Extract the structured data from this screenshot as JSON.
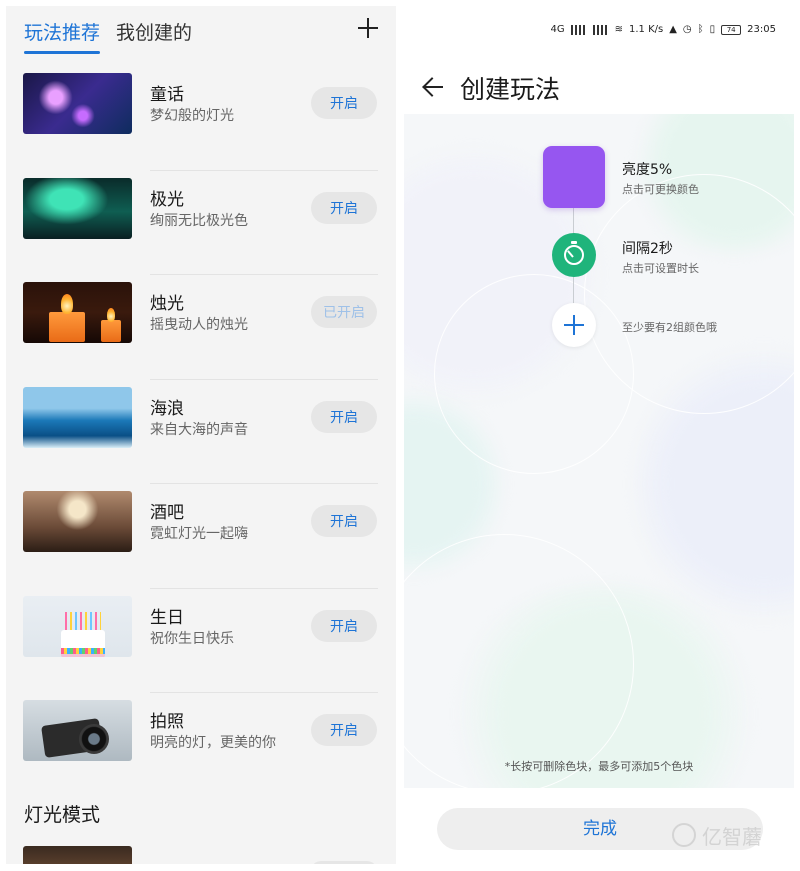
{
  "left_panel": {
    "tabs": [
      {
        "label": "玩法推荐",
        "active": true
      },
      {
        "label": "我创建的",
        "active": false
      }
    ],
    "items": [
      {
        "title": "童话",
        "desc": "梦幻般的灯光",
        "button": "开启",
        "enabled": true
      },
      {
        "title": "极光",
        "desc": "绚丽无比极光色",
        "button": "开启",
        "enabled": true
      },
      {
        "title": "烛光",
        "desc": "摇曳动人的烛光",
        "button": "已开启",
        "enabled": false
      },
      {
        "title": "海浪",
        "desc": "来自大海的声音",
        "button": "开启",
        "enabled": true
      },
      {
        "title": "酒吧",
        "desc": "霓虹灯光一起嗨",
        "button": "开启",
        "enabled": true
      },
      {
        "title": "生日",
        "desc": "祝你生日快乐",
        "button": "开启",
        "enabled": true
      },
      {
        "title": "拍照",
        "desc": "明亮的灯，更美的你",
        "button": "开启",
        "enabled": true
      }
    ],
    "section_title": "灯光模式"
  },
  "right_panel": {
    "status_bar": {
      "network": "4G",
      "speed": "1.1 K/s",
      "battery": "74",
      "time": "23:05"
    },
    "title": "创建玩法",
    "steps": [
      {
        "label": "亮度5%",
        "sub": "点击可更换颜色",
        "color": "#9656f0"
      },
      {
        "label": "间隔2秒",
        "sub": "点击可设置时长",
        "color": "#1fb47b"
      },
      {
        "label": "",
        "sub": "至少要有2组颜色哦"
      }
    ],
    "hint": "*长按可删除色块，最多可添加5个色块",
    "done_button": "完成",
    "watermark": "亿智蘑"
  },
  "colors": {
    "accent": "#1e74d6",
    "purple_block": "#9656f0",
    "timer_green": "#1fb47b"
  }
}
